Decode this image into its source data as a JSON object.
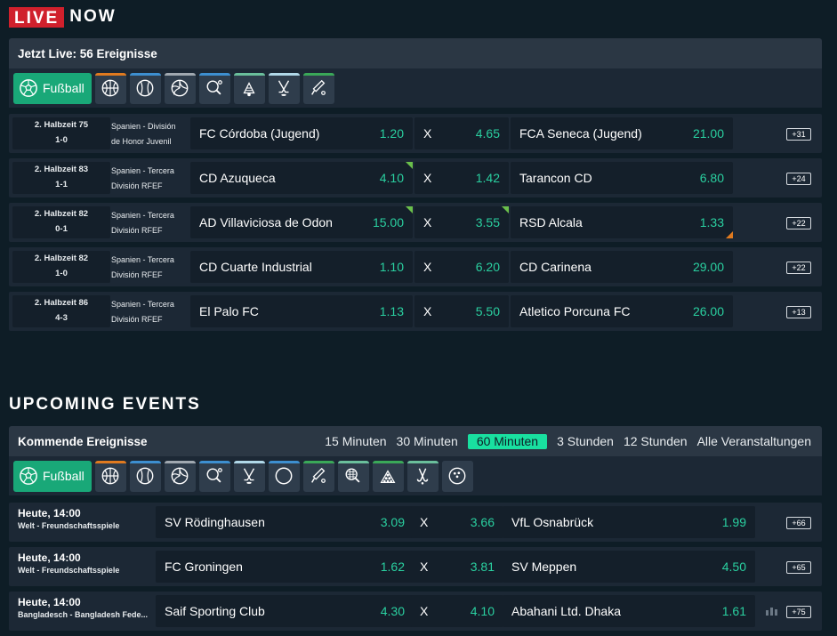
{
  "live": {
    "badge": "LIVE",
    "now": "NOW",
    "panel_title": "Jetzt Live: 56 Ereignisse",
    "sport_active": "Fußball",
    "sport_icons": [
      {
        "name": "basketball-icon",
        "bar": "#e07a1f"
      },
      {
        "name": "baseball-icon",
        "bar": "#3d8fd0"
      },
      {
        "name": "volleyball-icon",
        "bar": "#a0a8b0"
      },
      {
        "name": "table-tennis-icon",
        "bar": "#3d8fd0"
      },
      {
        "name": "badminton-icon",
        "bar": "#6abf9b"
      },
      {
        "name": "ice-hockey-icon",
        "bar": "#b0d8e8"
      },
      {
        "name": "cricket-icon",
        "bar": "#3aa858"
      }
    ],
    "events": [
      {
        "period": "2. Halbzeit 75",
        "score": "1-0",
        "league1": "Spanien - División",
        "league2": "de Honor Juvenil",
        "home": "FC Córdoba (Jugend)",
        "home_odd": "1.20",
        "x": "X",
        "draw_odd": "4.65",
        "away": "FCA Seneca (Jugend)",
        "away_odd": "21.00",
        "more": "+31"
      },
      {
        "period": "2. Halbzeit 83",
        "score": "1-1",
        "league1": "Spanien - Tercera",
        "league2": "División RFEF",
        "home": "CD Azuqueca",
        "home_odd": "4.10",
        "x": "X",
        "draw_odd": "1.42",
        "away": "Tarancon CD",
        "away_odd": "6.80",
        "more": "+24"
      },
      {
        "period": "2. Halbzeit 82",
        "score": "0-1",
        "league1": "Spanien - Tercera",
        "league2": "División RFEF",
        "home": "AD Villaviciosa de Odon",
        "home_odd": "15.00",
        "x": "X",
        "draw_odd": "3.55",
        "away": "RSD Alcala",
        "away_odd": "1.33",
        "more": "+22"
      },
      {
        "period": "2. Halbzeit 82",
        "score": "1-0",
        "league1": "Spanien - Tercera",
        "league2": "División RFEF",
        "home": "CD Cuarte Industrial",
        "home_odd": "1.10",
        "x": "X",
        "draw_odd": "6.20",
        "away": "CD Carinena",
        "away_odd": "29.00",
        "more": "+22"
      },
      {
        "period": "2. Halbzeit 86",
        "score": "4-3",
        "league1": "Spanien - Tercera",
        "league2": "División RFEF",
        "home": "El Palo FC",
        "home_odd": "1.13",
        "x": "X",
        "draw_odd": "5.50",
        "away": "Atletico Porcuna FC",
        "away_odd": "26.00",
        "more": "+13"
      }
    ]
  },
  "upcoming": {
    "title": "UPCOMING EVENTS",
    "panel_title": "Kommende Ereignisse",
    "filters": [
      "15 Minuten",
      "30 Minuten",
      "60 Minuten",
      "3 Stunden",
      "12 Stunden",
      "Alle Veranstaltungen"
    ],
    "active_filter": "60 Minuten",
    "sport_active": "Fußball",
    "sport_icons": [
      {
        "name": "basketball-icon",
        "bar": "#e07a1f"
      },
      {
        "name": "baseball-icon",
        "bar": "#3d8fd0"
      },
      {
        "name": "volleyball-icon",
        "bar": "#a0a8b0"
      },
      {
        "name": "table-tennis-icon",
        "bar": "#3d8fd0"
      },
      {
        "name": "ice-hockey-icon",
        "bar": "#b0d8e8"
      },
      {
        "name": "circle-sport-icon",
        "bar": "#3d8fd0"
      },
      {
        "name": "cricket-icon",
        "bar": "#3aa858"
      },
      {
        "name": "tennis-racket-icon",
        "bar": "#6abf9b"
      },
      {
        "name": "snooker-icon",
        "bar": "#3aa858"
      },
      {
        "name": "field-hockey-icon",
        "bar": "#6abf9b"
      },
      {
        "name": "bowling-icon",
        "bar": "#2f3d4c"
      }
    ],
    "events": [
      {
        "time": "Heute, 14:00",
        "league": "Welt - Freundschaftsspiele",
        "home": "SV Rödinghausen",
        "home_odd": "3.09",
        "x": "X",
        "draw_odd": "3.66",
        "away": "VfL Osnabrück",
        "away_odd": "1.99",
        "more": "+66"
      },
      {
        "time": "Heute, 14:00",
        "league": "Welt - Freundschaftsspiele",
        "home": "FC Groningen",
        "home_odd": "1.62",
        "x": "X",
        "draw_odd": "3.81",
        "away": "SV Meppen",
        "away_odd": "4.50",
        "more": "+65"
      },
      {
        "time": "Heute, 14:00",
        "league": "Bangladesch - Bangladesh Fede...",
        "home": "Saif Sporting Club",
        "home_odd": "4.30",
        "x": "X",
        "draw_odd": "4.10",
        "away": "Abahani Ltd. Dhaka",
        "away_odd": "1.61",
        "more": "+75"
      }
    ]
  },
  "colors": {
    "accent": "#19a878",
    "odd": "#2ad0a0",
    "live_red": "#d0202c",
    "bg": "#0e1d26"
  }
}
